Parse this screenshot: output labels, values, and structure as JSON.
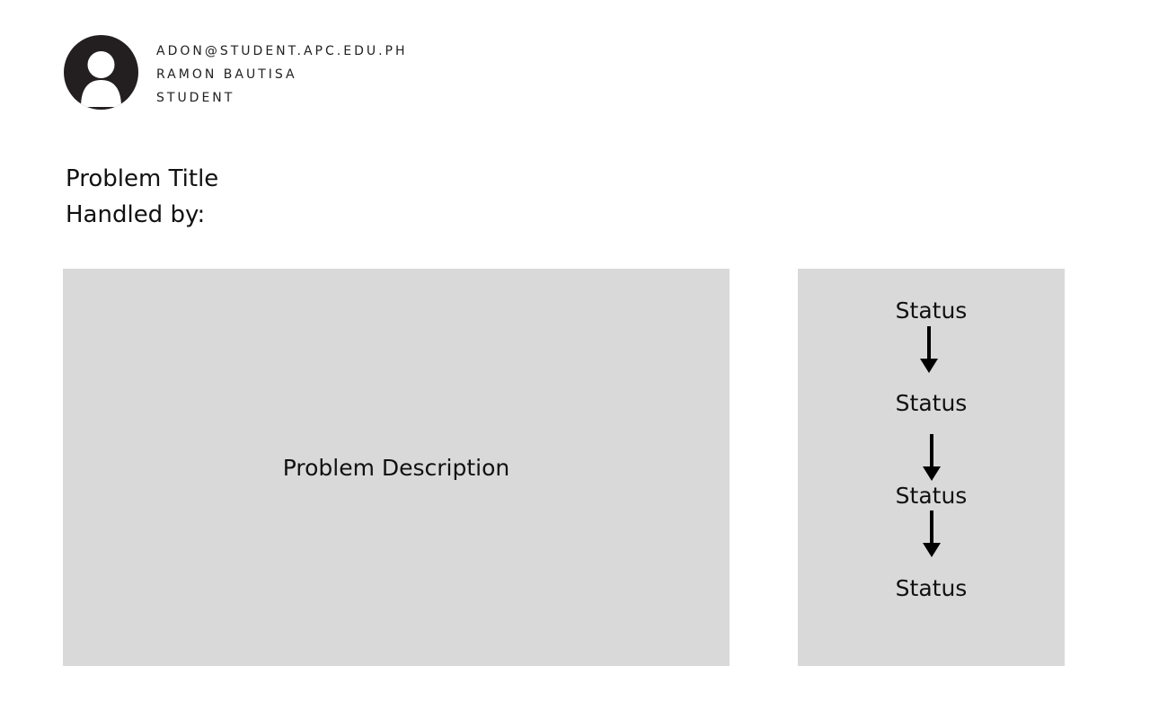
{
  "user": {
    "email": "ADON@STUDENT.APC.EDU.PH",
    "name": "RAMON BAUTISA",
    "role": "STUDENT",
    "avatar_icon": "user-avatar-icon"
  },
  "problem": {
    "title": "Problem Title",
    "handled_by_label": "Handled by:",
    "description": "Problem Description"
  },
  "status_flow": {
    "statuses": [
      "Status",
      "Status",
      "Status",
      "Status"
    ],
    "arrow_icon": "arrow-down-icon"
  },
  "colors": {
    "panel_background": "#d9d9d9",
    "avatar_background": "#231f20"
  }
}
